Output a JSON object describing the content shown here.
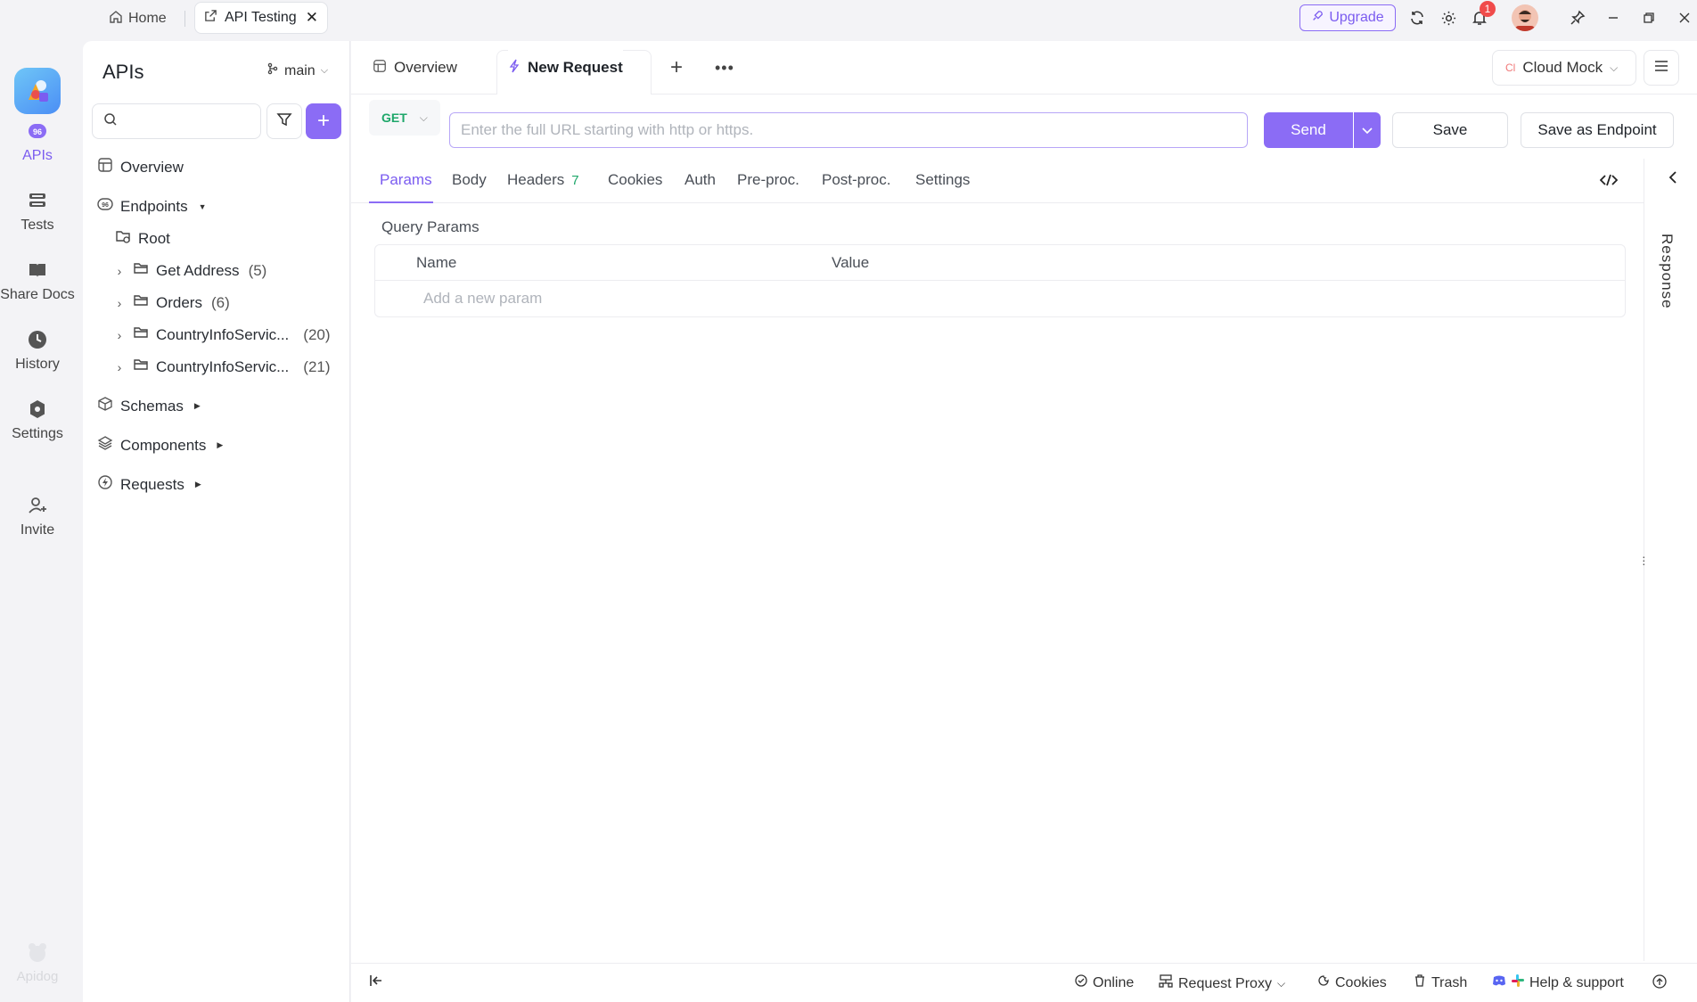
{
  "titlebar": {
    "home_tab": "Home",
    "active_tab": "API Testing",
    "upgrade": "Upgrade",
    "notification_count": "1"
  },
  "rail": {
    "items": [
      {
        "label": "APIs",
        "icon": "apis-icon"
      },
      {
        "label": "Tests",
        "icon": "tests-icon"
      },
      {
        "label": "Share Docs",
        "icon": "book-icon"
      },
      {
        "label": "History",
        "icon": "clock-icon"
      },
      {
        "label": "Settings",
        "icon": "gear-icon"
      },
      {
        "label": "Invite",
        "icon": "user-plus-icon"
      }
    ],
    "brand": "Apidog"
  },
  "sidebar": {
    "title": "APIs",
    "branch": "main",
    "search_placeholder": "",
    "tree": {
      "overview": "Overview",
      "endpoints": "Endpoints",
      "root": "Root",
      "folders": [
        {
          "name": "Get Address",
          "count": "(5)"
        },
        {
          "name": "Orders",
          "count": "(6)"
        },
        {
          "name": "CountryInfoServic...",
          "count": "(20)"
        },
        {
          "name": "CountryInfoServic...",
          "count": "(21)"
        }
      ],
      "schemas": "Schemas",
      "components": "Components",
      "requests": "Requests"
    }
  },
  "main": {
    "tabs": {
      "overview": "Overview",
      "new_request": "New Request"
    },
    "environment": "Cloud Mock",
    "environment_badge": "Cl",
    "request": {
      "method": "GET",
      "url_value": "",
      "url_placeholder": "Enter the full URL starting with http or https.",
      "send": "Send",
      "save": "Save",
      "save_as_endpoint": "Save as Endpoint"
    },
    "sub_tabs": {
      "params": "Params",
      "body": "Body",
      "headers": "Headers",
      "headers_count": "7",
      "cookies": "Cookies",
      "auth": "Auth",
      "pre_proc": "Pre-proc.",
      "post_proc": "Post-proc.",
      "settings": "Settings"
    },
    "query_params": {
      "label": "Query Params",
      "col_name": "Name",
      "col_value": "Value",
      "add_placeholder": "Add a new param"
    },
    "response_label": "Response"
  },
  "statusbar": {
    "online": "Online",
    "proxy": "Request Proxy",
    "cookies": "Cookies",
    "trash": "Trash",
    "help": "Help & support"
  },
  "colors": {
    "accent": "#8b6cf5",
    "method_get": "#1ea76a",
    "notification": "#f04b4b"
  }
}
